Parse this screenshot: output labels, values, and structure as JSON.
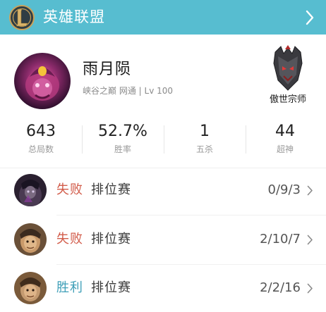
{
  "header": {
    "title": "英雄联盟",
    "logo_icon": "lol-logo-icon",
    "nav_icon": "chevron-right-icon",
    "background": "#57bdd0"
  },
  "profile": {
    "name": "雨月陨",
    "server": "峡谷之巅 网通",
    "separator": "|",
    "level": "Lv 100",
    "rank": "傲世宗师",
    "avatar_icon": "champion-avatar",
    "rank_icon": "grandmaster-emblem-icon"
  },
  "stats": [
    {
      "value": "643",
      "label": "总局数"
    },
    {
      "value": "52.7%",
      "label": "胜率"
    },
    {
      "value": "1",
      "label": "五杀"
    },
    {
      "value": "44",
      "label": "超神"
    }
  ],
  "matches": [
    {
      "result": "失败",
      "outcome": "lose",
      "mode": "排位赛",
      "kda": "0/9/3"
    },
    {
      "result": "失败",
      "outcome": "lose",
      "mode": "排位赛",
      "kda": "2/10/7"
    },
    {
      "result": "胜利",
      "outcome": "win",
      "mode": "排位赛",
      "kda": "2/2/16"
    }
  ],
  "colors": {
    "lose": "#d25c4a",
    "win": "#3f9fb8",
    "muted": "#9a9a9a"
  }
}
